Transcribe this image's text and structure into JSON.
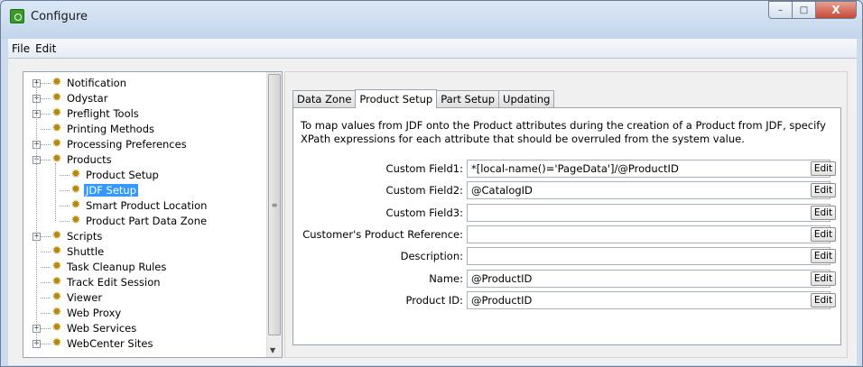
{
  "window": {
    "title": "Configure",
    "controls": {
      "minimize": "–",
      "maximize": "□",
      "close": "X"
    }
  },
  "menu": [
    "File",
    "Edit"
  ],
  "tree": [
    {
      "label": "Notification",
      "expandable": true,
      "expander": "+",
      "level": 0
    },
    {
      "label": "Odystar",
      "expandable": true,
      "expander": "+",
      "level": 0
    },
    {
      "label": "Preflight Tools",
      "expandable": true,
      "expander": "+",
      "level": 0
    },
    {
      "label": "Printing Methods",
      "expandable": false,
      "level": 0
    },
    {
      "label": "Processing Preferences",
      "expandable": true,
      "expander": "+",
      "level": 0
    },
    {
      "label": "Products",
      "expandable": true,
      "expander": "−",
      "level": 0
    },
    {
      "label": "Product Setup",
      "expandable": false,
      "level": 1
    },
    {
      "label": "JDF Setup",
      "expandable": false,
      "level": 1,
      "selected": true
    },
    {
      "label": "Smart Product Location",
      "expandable": false,
      "level": 1
    },
    {
      "label": "Product Part Data Zone",
      "expandable": false,
      "level": 1
    },
    {
      "label": "Scripts",
      "expandable": true,
      "expander": "+",
      "level": 0
    },
    {
      "label": "Shuttle",
      "expandable": false,
      "level": 0
    },
    {
      "label": "Task Cleanup Rules",
      "expandable": false,
      "level": 0
    },
    {
      "label": "Track Edit Session",
      "expandable": false,
      "level": 0
    },
    {
      "label": "Viewer",
      "expandable": false,
      "level": 0
    },
    {
      "label": "Web Proxy",
      "expandable": false,
      "level": 0
    },
    {
      "label": "Web Services",
      "expandable": true,
      "expander": "+",
      "level": 0
    },
    {
      "label": "WebCenter Sites",
      "expandable": true,
      "expander": "+",
      "level": 0
    }
  ],
  "tabs": [
    {
      "label": "Data Zone",
      "active": false
    },
    {
      "label": "Product Setup",
      "active": true
    },
    {
      "label": "Part Setup",
      "active": false
    },
    {
      "label": "Updating",
      "active": false
    }
  ],
  "description": "To map values from JDF onto the Product attributes during the creation of a Product from JDF, specify XPath expressions for each attribute that should be overruled from the system value.",
  "fields": [
    {
      "label": "Custom Field1:",
      "value": "*[local-name()='PageData']/@ProductID"
    },
    {
      "label": "Custom Field2:",
      "value": "@CatalogID"
    },
    {
      "label": "Custom Field3:",
      "value": ""
    },
    {
      "label": "Customer's Product Reference:",
      "value": ""
    },
    {
      "label": "Description:",
      "value": ""
    },
    {
      "label": "Name:",
      "value": "@ProductID"
    },
    {
      "label": "Product ID:",
      "value": "@ProductID"
    }
  ],
  "edit_label": "Edit",
  "icons": {
    "node": "gear-icon",
    "app": "configure-app-icon"
  },
  "colors": {
    "selection": "#3399ff",
    "gear": "#b58a0c",
    "titlebar": "#c3d5ec"
  }
}
